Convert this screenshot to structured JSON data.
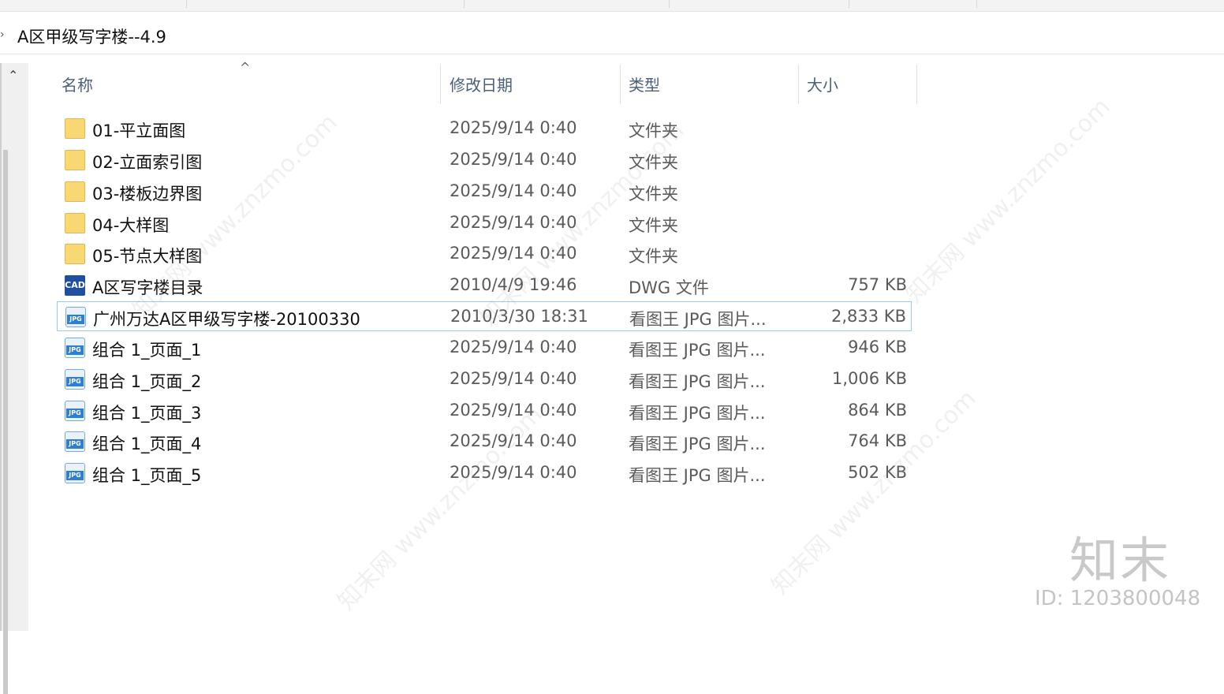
{
  "address": {
    "path": "A区甲级写字楼--4.9"
  },
  "columns": {
    "name": "名称",
    "modified": "修改日期",
    "type": "类型",
    "size": "大小"
  },
  "files": [
    {
      "name": "01-平立面图",
      "modified": "2025/9/14 0:40",
      "type": "文件夹",
      "size": "",
      "icon": "folder-icon",
      "selected": false
    },
    {
      "name": "02-立面索引图",
      "modified": "2025/9/14 0:40",
      "type": "文件夹",
      "size": "",
      "icon": "folder-icon",
      "selected": false
    },
    {
      "name": "03-楼板边界图",
      "modified": "2025/9/14 0:40",
      "type": "文件夹",
      "size": "",
      "icon": "folder-icon",
      "selected": false
    },
    {
      "name": "04-大样图",
      "modified": "2025/9/14 0:40",
      "type": "文件夹",
      "size": "",
      "icon": "folder-icon",
      "selected": false
    },
    {
      "name": "05-节点大样图",
      "modified": "2025/9/14 0:40",
      "type": "文件夹",
      "size": "",
      "icon": "folder-icon",
      "selected": false
    },
    {
      "name": "A区写字楼目录",
      "modified": "2010/4/9 19:46",
      "type": "DWG 文件",
      "size": "757 KB",
      "icon": "cad-file-icon",
      "selected": false
    },
    {
      "name": "广州万达A区甲级写字楼-20100330",
      "modified": "2010/3/30 18:31",
      "type": "看图王 JPG 图片...",
      "size": "2,833 KB",
      "icon": "jpg-file-icon",
      "selected": true
    },
    {
      "name": "组合 1_页面_1",
      "modified": "2025/9/14 0:40",
      "type": "看图王 JPG 图片...",
      "size": "946 KB",
      "icon": "jpg-file-icon",
      "selected": false
    },
    {
      "name": "组合 1_页面_2",
      "modified": "2025/9/14 0:40",
      "type": "看图王 JPG 图片...",
      "size": "1,006 KB",
      "icon": "jpg-file-icon",
      "selected": false
    },
    {
      "name": "组合 1_页面_3",
      "modified": "2025/9/14 0:40",
      "type": "看图王 JPG 图片...",
      "size": "864 KB",
      "icon": "jpg-file-icon",
      "selected": false
    },
    {
      "name": "组合 1_页面_4",
      "modified": "2025/9/14 0:40",
      "type": "看图王 JPG 图片...",
      "size": "764 KB",
      "icon": "jpg-file-icon",
      "selected": false
    },
    {
      "name": "组合 1_页面_5",
      "modified": "2025/9/14 0:40",
      "type": "看图王 JPG 图片...",
      "size": "502 KB",
      "icon": "jpg-file-icon",
      "selected": false
    }
  ],
  "icon_labels": {
    "cad": "CAD",
    "jpg": "JPG"
  },
  "watermark": {
    "brand": "知末",
    "id": "ID: 1203800048",
    "text": "知末网 www.znzmo.com"
  },
  "colors": {
    "selection_border": "#99c9ef",
    "folder": "#f8d775",
    "header_text": "#4c607a"
  }
}
